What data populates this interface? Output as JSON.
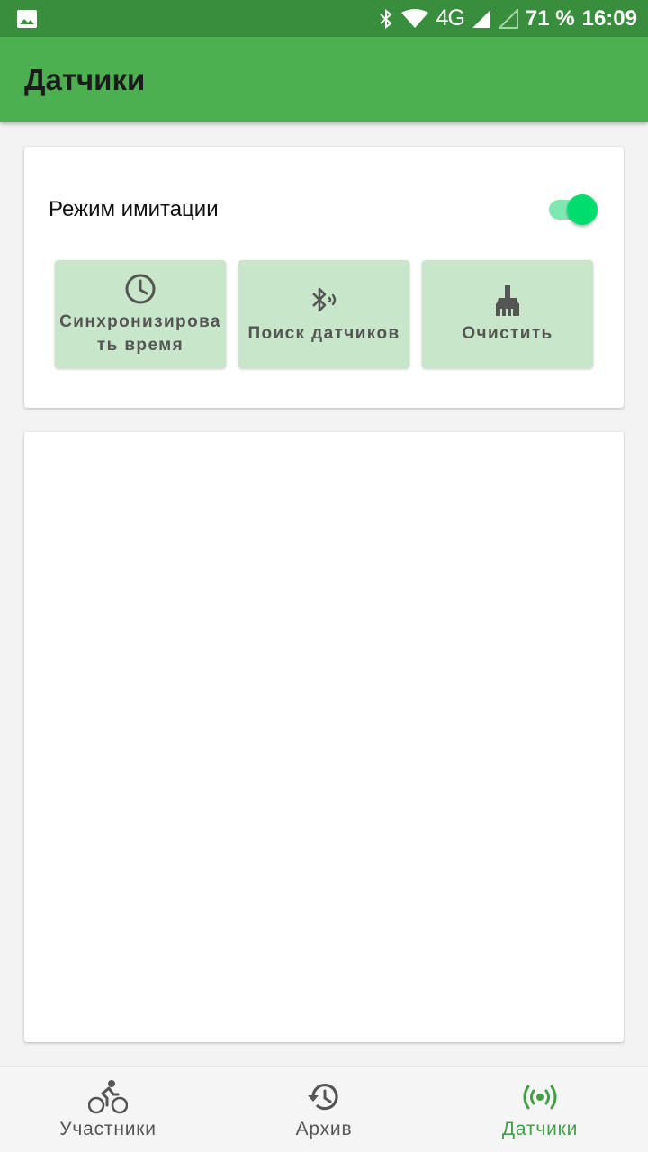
{
  "status_bar": {
    "network": "4G",
    "battery": "71 %",
    "time": "16:09",
    "icons": [
      "image-icon",
      "bluetooth-icon",
      "wifi-icon",
      "signal-icon",
      "signal-empty-icon"
    ]
  },
  "app_bar": {
    "title": "Датчики"
  },
  "controls": {
    "imitation_mode_label": "Режим имитации",
    "imitation_mode_on": true,
    "buttons": [
      {
        "icon": "clock-icon",
        "label": "Синхронизировать время"
      },
      {
        "icon": "bluetooth-searching-icon",
        "label": "Поиск датчиков"
      },
      {
        "icon": "broom-icon",
        "label": "Очистить"
      }
    ]
  },
  "sensors_list": {
    "items": []
  },
  "bottom_nav": {
    "items": [
      {
        "icon": "bike-icon",
        "label": "Участники",
        "active": false
      },
      {
        "icon": "history-icon",
        "label": "Архив",
        "active": false
      },
      {
        "icon": "sensors-icon",
        "label": "Датчики",
        "active": true
      }
    ]
  },
  "colors": {
    "status_bar": "#388e3c",
    "app_bar": "#4caf50",
    "button_bg": "#c8e6c9",
    "switch_thumb": "#00dd6e",
    "active_nav": "#43a047"
  }
}
